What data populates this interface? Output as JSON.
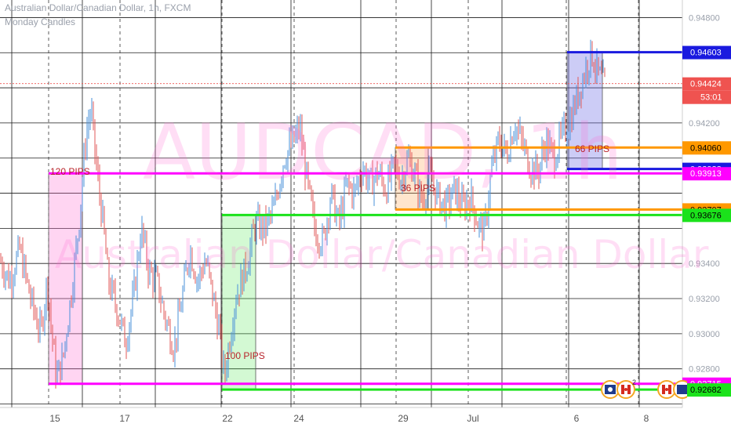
{
  "header": {
    "symbol_title": "Australian Dollar/Canadian Dollar, 1h, FXCM",
    "indicator": "Monday Candles"
  },
  "watermark": {
    "large": "AUDCAD, 1h",
    "small": "Australian Dollar/Canadian Dollar"
  },
  "colors": {
    "up": "#4a90d9",
    "down": "#e05a5a",
    "magenta": "#ff00ff",
    "green": "#1be21b",
    "orange": "#ff9800",
    "blue": "#1a1adf",
    "last_price": "#ef5350"
  },
  "chart_data": {
    "type": "candlestick",
    "title": "Australian Dollar/Canadian Dollar, 1h, FXCM",
    "ylim": [
      0.9258,
      0.949
    ],
    "xlim": [
      0,
      932
    ],
    "price_ticks": [
      0.948,
      0.942,
      0.934,
      0.932,
      0.93,
      0.928
    ],
    "date_ticks": [
      {
        "label": "15",
        "x": 70
      },
      {
        "label": "17",
        "x": 159
      },
      {
        "label": "22",
        "x": 290
      },
      {
        "label": "24",
        "x": 381
      },
      {
        "label": "29",
        "x": 514
      },
      {
        "label": "Jul",
        "x": 603
      },
      {
        "label": "6",
        "x": 735
      },
      {
        "label": "8",
        "x": 824
      }
    ],
    "price_labels": [
      {
        "value": "0.94603",
        "price": 0.94603,
        "color": "#1a1adf"
      },
      {
        "value": "0.94424",
        "price": 0.94424,
        "color": "#ef5350"
      },
      {
        "value": "0.94060",
        "price": 0.9406,
        "color": "#ff9800"
      },
      {
        "value": "0.93938",
        "price": 0.93938,
        "color": "#1a1adf"
      },
      {
        "value": "0.93913",
        "price": 0.93913,
        "color": "#ff00ff"
      },
      {
        "value": "0.93707",
        "price": 0.93707,
        "color": "#ff9800"
      },
      {
        "value": "0.93676",
        "price": 0.93676,
        "color": "#1be21b"
      },
      {
        "value": "0.92715",
        "price": 0.92715,
        "color": "#ff00ff"
      },
      {
        "value": "0.92682",
        "price": 0.92682,
        "color": "#1be21b"
      }
    ],
    "countdown": "53:01",
    "last_price": 0.94424,
    "levels": [
      {
        "price": 0.94603,
        "color": "#1a1adf"
      },
      {
        "price": 0.9406,
        "color": "#ff9800"
      },
      {
        "price": 0.93938,
        "color": "#1a1adf"
      },
      {
        "price": 0.93913,
        "color": "#ff00ff"
      },
      {
        "price": 0.93707,
        "color": "#ff9800"
      },
      {
        "price": 0.93676,
        "color": "#1be21b"
      },
      {
        "price": 0.92715,
        "color": "#ff00ff"
      },
      {
        "price": 0.92682,
        "color": "#1be21b"
      }
    ],
    "monday_ranges": [
      {
        "label": "120 PIPS",
        "color": "#ff00ff",
        "fill": "rgba(255,105,210,0.28)",
        "high": 0.93913,
        "low": 0.92715
      },
      {
        "label": "100 PIPS",
        "color": "#1be21b",
        "fill": "rgba(80,230,80,0.25)",
        "high": 0.93676,
        "low": 0.92682
      },
      {
        "label": "36 PIPS",
        "color": "#ff9800",
        "fill": "rgba(255,170,90,0.30)",
        "high": 0.9406,
        "low": 0.93707
      },
      {
        "label": "66 PIPS",
        "color": "#1a1adf",
        "fill": "rgba(110,110,230,0.35)",
        "high": 0.94603,
        "low": 0.93938
      }
    ],
    "price_path": [
      [
        0,
        0.9342
      ],
      [
        12,
        0.933
      ],
      [
        25,
        0.9348
      ],
      [
        40,
        0.9318
      ],
      [
        52,
        0.93
      ],
      [
        60,
        0.933
      ],
      [
        66,
        0.93
      ],
      [
        72,
        0.9275
      ],
      [
        80,
        0.9285
      ],
      [
        90,
        0.932
      ],
      [
        100,
        0.936
      ],
      [
        110,
        0.9415
      ],
      [
        116,
        0.9428
      ],
      [
        124,
        0.939
      ],
      [
        132,
        0.936
      ],
      [
        138,
        0.933
      ],
      [
        145,
        0.932
      ],
      [
        152,
        0.931
      ],
      [
        160,
        0.9295
      ],
      [
        170,
        0.932
      ],
      [
        180,
        0.936
      ],
      [
        190,
        0.9335
      ],
      [
        200,
        0.933
      ],
      [
        210,
        0.931
      ],
      [
        222,
        0.9292
      ],
      [
        232,
        0.932
      ],
      [
        242,
        0.9348
      ],
      [
        252,
        0.933
      ],
      [
        262,
        0.9342
      ],
      [
        272,
        0.932
      ],
      [
        280,
        0.93
      ],
      [
        286,
        0.9275
      ],
      [
        300,
        0.932
      ],
      [
        315,
        0.934
      ],
      [
        325,
        0.9362
      ],
      [
        338,
        0.936
      ],
      [
        350,
        0.9372
      ],
      [
        362,
        0.94
      ],
      [
        375,
        0.941
      ],
      [
        382,
        0.9418
      ],
      [
        392,
        0.9385
      ],
      [
        402,
        0.9358
      ],
      [
        412,
        0.9352
      ],
      [
        422,
        0.938
      ],
      [
        432,
        0.9362
      ],
      [
        442,
        0.9385
      ],
      [
        452,
        0.938
      ],
      [
        462,
        0.9395
      ],
      [
        472,
        0.9385
      ],
      [
        482,
        0.9392
      ],
      [
        492,
        0.9382
      ],
      [
        502,
        0.9395
      ],
      [
        512,
        0.9388
      ],
      [
        520,
        0.94
      ],
      [
        528,
        0.9392
      ],
      [
        538,
        0.9375
      ],
      [
        548,
        0.939
      ],
      [
        558,
        0.9378
      ],
      [
        568,
        0.9372
      ],
      [
        580,
        0.9382
      ],
      [
        590,
        0.9372
      ],
      [
        600,
        0.9378
      ],
      [
        610,
        0.9362
      ],
      [
        618,
        0.9358
      ],
      [
        626,
        0.9392
      ],
      [
        636,
        0.941
      ],
      [
        646,
        0.9402
      ],
      [
        656,
        0.942
      ],
      [
        666,
        0.9408
      ],
      [
        676,
        0.9395
      ],
      [
        686,
        0.9392
      ],
      [
        696,
        0.941
      ],
      [
        706,
        0.94
      ],
      [
        716,
        0.9412
      ],
      [
        726,
        0.942
      ],
      [
        736,
        0.9435
      ],
      [
        746,
        0.945
      ],
      [
        754,
        0.946
      ],
      [
        762,
        0.9448
      ],
      [
        770,
        0.9442
      ]
    ]
  }
}
